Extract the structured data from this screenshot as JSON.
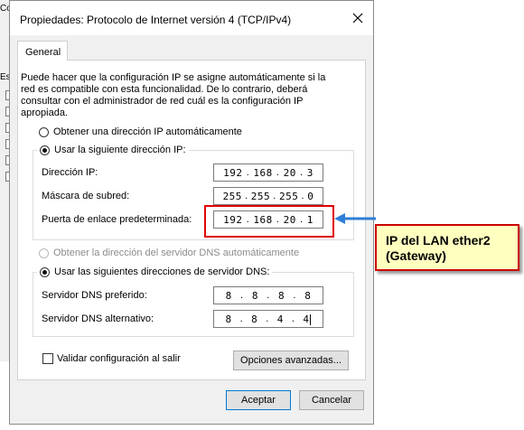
{
  "background": {
    "fragments": [
      "Conec",
      "Es"
    ]
  },
  "dialog": {
    "title": "Propiedades: Protocolo de Internet versión 4 (TCP/IPv4)",
    "tab": "General",
    "description": "Puede hacer que la configuración IP se asigne automáticamente si la red es compatible con esta funcionalidad. De lo contrario, deberá consultar con el administrador de red cuál es la configuración IP apropiada.",
    "ip_auto_label": "Obtener una dirección IP automáticamente",
    "ip_manual_label": "Usar la siguiente dirección IP:",
    "ip_fields": [
      {
        "label": "Dirección IP:",
        "octets": [
          "192",
          "168",
          "20",
          "3"
        ]
      },
      {
        "label": "Máscara de subred:",
        "octets": [
          "255",
          "255",
          "255",
          "0"
        ]
      },
      {
        "label": "Puerta de enlace predeterminada:",
        "octets": [
          "192",
          "168",
          "20",
          "1"
        ]
      }
    ],
    "dns_auto_label": "Obtener la dirección del servidor DNS automáticamente",
    "dns_manual_label": "Usar las siguientes direcciones de servidor DNS:",
    "dns_fields": [
      {
        "label": "Servidor DNS preferido:",
        "octets": [
          "8",
          "8",
          "8",
          "8"
        ]
      },
      {
        "label": "Servidor DNS alternativo:",
        "octets": [
          "8",
          "8",
          "4",
          "4"
        ]
      }
    ],
    "validate_label": "Validar configuración al salir",
    "advanced_button": "Opciones avanzadas...",
    "ok_button": "Aceptar",
    "cancel_button": "Cancelar"
  },
  "annotation": {
    "line1": "IP del LAN ether2",
    "line2": "(Gateway)",
    "highlight_color": "#e00000",
    "arrow_color": "#2e7fd6",
    "box_color": "#ffffc0"
  }
}
